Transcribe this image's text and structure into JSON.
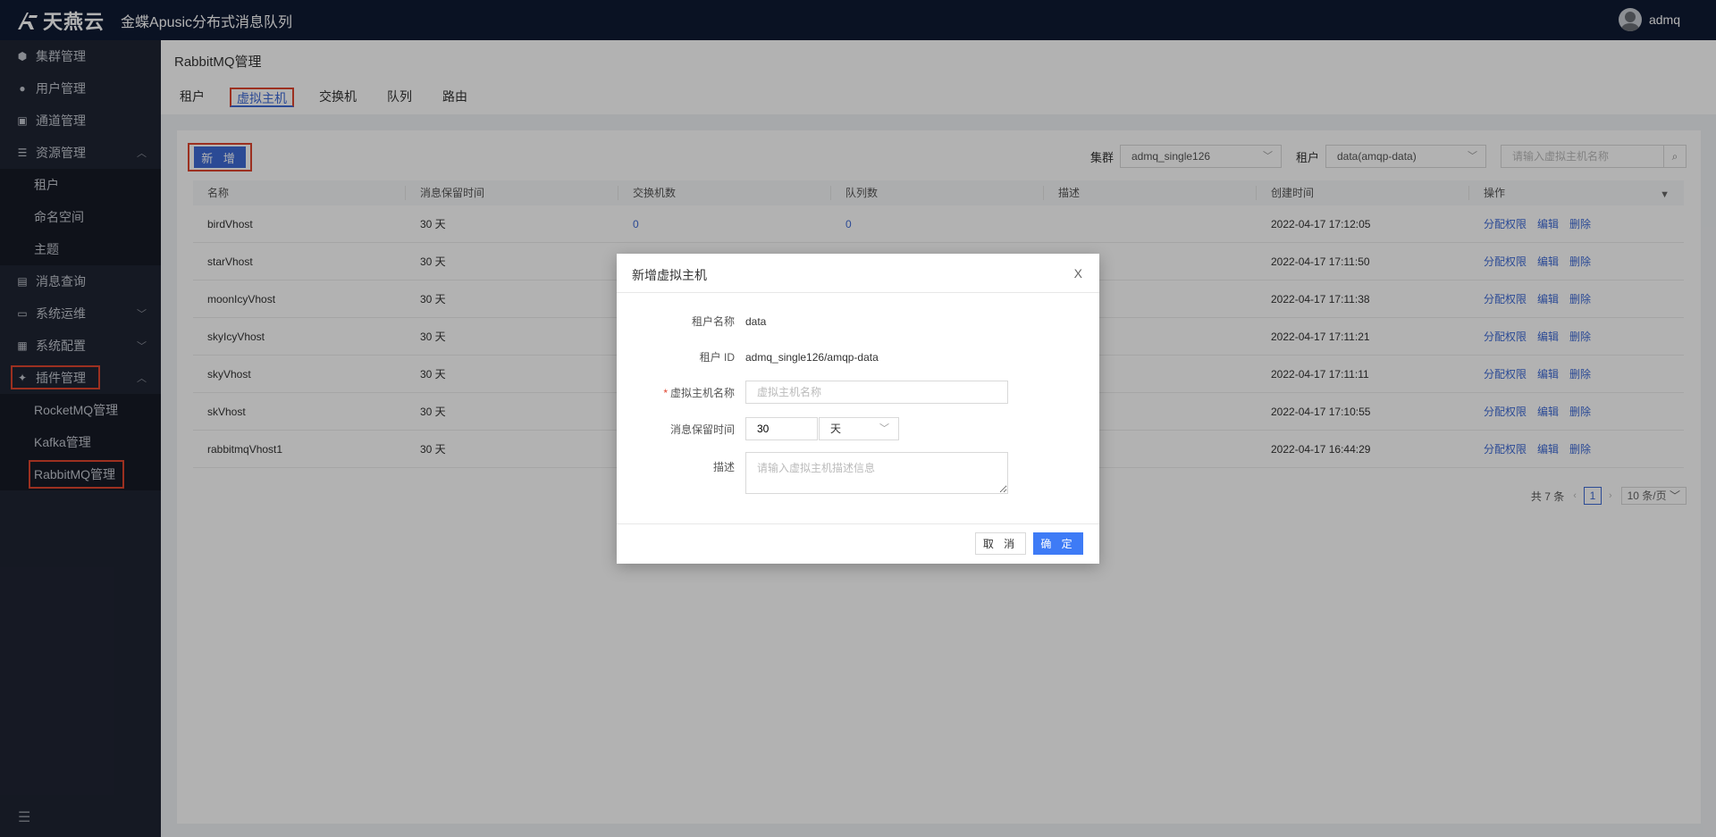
{
  "brand": {
    "logo_text": "天燕云",
    "app_title": "金蝶Apusic分布式消息队列"
  },
  "user": {
    "name": "admq"
  },
  "sidebar": {
    "items": [
      {
        "label": "集群管理",
        "icon": "cube-icon"
      },
      {
        "label": "用户管理",
        "icon": "user-icon"
      },
      {
        "label": "通道管理",
        "icon": "channel-icon"
      },
      {
        "label": "资源管理",
        "icon": "server-icon",
        "expanded": true,
        "children": [
          "租户",
          "命名空间",
          "主题"
        ]
      },
      {
        "label": "消息查询",
        "icon": "doc-search-icon"
      },
      {
        "label": "系统运维",
        "icon": "monitor-icon"
      },
      {
        "label": "系统配置",
        "icon": "config-icon"
      },
      {
        "label": "插件管理",
        "icon": "plugin-icon",
        "expanded": true,
        "children": [
          "RocketMQ管理",
          "Kafka管理",
          "RabbitMQ管理"
        ]
      }
    ]
  },
  "page": {
    "title": "RabbitMQ管理",
    "tabs": [
      "租户",
      "虚拟主机",
      "交换机",
      "队列",
      "路由"
    ],
    "active_tab": "虚拟主机"
  },
  "toolbar": {
    "add_label": "新 增",
    "cluster_label": "集群",
    "cluster_value": "admq_single126",
    "tenant_label": "租户",
    "tenant_value": "data(amqp-data)",
    "search_placeholder": "请输入虚拟主机名称"
  },
  "table": {
    "columns": [
      "名称",
      "消息保留时间",
      "交换机数",
      "队列数",
      "描述",
      "创建时间",
      "操作"
    ],
    "rows": [
      {
        "name": "birdVhost",
        "retention": "30 天",
        "exchanges": "0",
        "queues": "0",
        "desc": "",
        "created": "2022-04-17 17:12:05"
      },
      {
        "name": "starVhost",
        "retention": "30 天",
        "exchanges": "",
        "queues": "",
        "desc": "",
        "created": "2022-04-17 17:11:50"
      },
      {
        "name": "moonIcyVhost",
        "retention": "30 天",
        "exchanges": "",
        "queues": "",
        "desc": "",
        "created": "2022-04-17 17:11:38"
      },
      {
        "name": "skyIcyVhost",
        "retention": "30 天",
        "exchanges": "",
        "queues": "",
        "desc": "",
        "created": "2022-04-17 17:11:21"
      },
      {
        "name": "skyVhost",
        "retention": "30 天",
        "exchanges": "",
        "queues": "",
        "desc": "",
        "created": "2022-04-17 17:11:11"
      },
      {
        "name": "skVhost",
        "retention": "30 天",
        "exchanges": "",
        "queues": "",
        "desc": "",
        "created": "2022-04-17 17:10:55"
      },
      {
        "name": "rabbitmqVhost1",
        "retention": "30 天",
        "exchanges": "",
        "queues": "",
        "desc": "",
        "created": "2022-04-17 16:44:29"
      }
    ],
    "actions": [
      "分配权限",
      "编辑",
      "删除"
    ]
  },
  "pagination": {
    "total": "共 7 条",
    "page": "1",
    "size": "10 条/页"
  },
  "modal": {
    "title": "新增虚拟主机",
    "close": "X",
    "tenant_name_label": "租户名称",
    "tenant_name_value": "data",
    "tenant_id_label": "租户 ID",
    "tenant_id_value": "admq_single126/amqp-data",
    "vhost_name_label": "虚拟主机名称",
    "vhost_name_placeholder": "虚拟主机名称",
    "retention_label": "消息保留时间",
    "retention_value": "30",
    "retention_unit": "天",
    "desc_label": "描述",
    "desc_placeholder": "请输入虚拟主机描述信息",
    "cancel_label": "取 消",
    "ok_label": "确 定"
  },
  "colors": {
    "accent": "#3e6ad6",
    "header_bg": "#0f1a33",
    "sidebar_bg": "#1f2433",
    "highlight": "#e0452f"
  }
}
